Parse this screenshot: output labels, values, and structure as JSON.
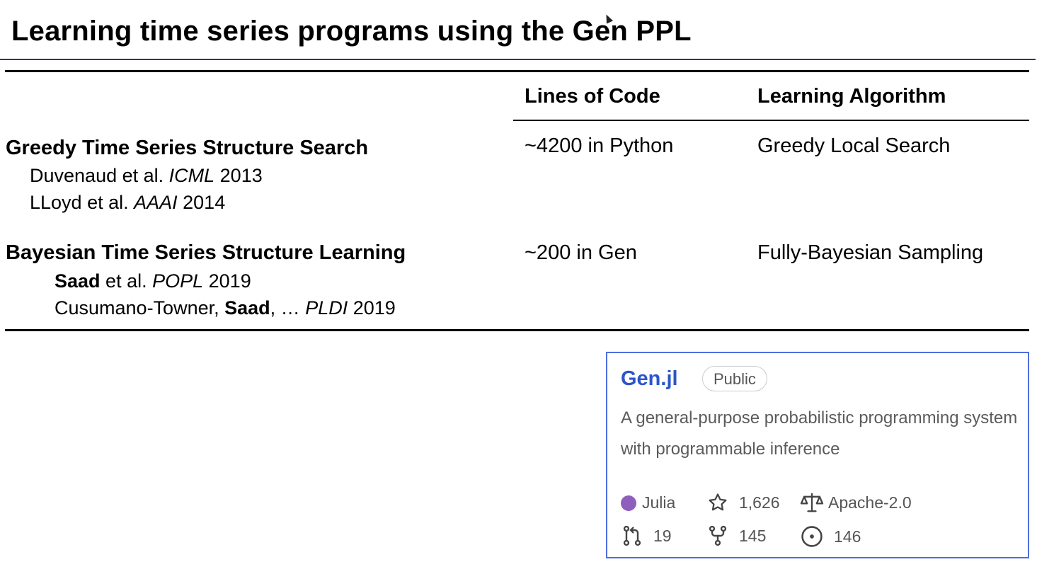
{
  "slide": {
    "title": "Learning time series programs using the Gen PPL"
  },
  "table": {
    "headers": [
      "Lines of Code",
      "Learning Algorithm"
    ],
    "rows": [
      {
        "name": "Greedy Time Series Structure Search",
        "lines_of_code": "~4200 in Python",
        "algorithm": "Greedy Local Search",
        "refs": [
          {
            "pre": "Duvenaud et al. ",
            "venue": "ICML",
            "year": " 2013"
          },
          {
            "pre": "LLoyd et al. ",
            "venue": "AAAI",
            "year": " 2014"
          }
        ]
      },
      {
        "name": "Bayesian Time Series Structure Learning",
        "lines_of_code": "~200 in Gen",
        "algorithm": "Fully-Bayesian Sampling",
        "refs": [
          {
            "bold": "Saad",
            "pre": " et al. ",
            "venue": "POPL",
            "year": " 2019"
          },
          {
            "lead": "Cusumano-Towner, ",
            "bold": "Saad",
            "pre": ", … ",
            "venue": "PLDI",
            "year": " 2019"
          }
        ]
      }
    ]
  },
  "repo_card": {
    "name": "Gen.jl",
    "visibility": "Public",
    "description": "A general-purpose probabilistic programming system with programmable inference",
    "language": "Julia",
    "language_color": "#8e5fbd",
    "stars": "1,626",
    "license": "Apache-2.0",
    "pull_requests": "19",
    "forks": "145",
    "issues": "146",
    "accent_color": "#2b56c9",
    "border_color": "#4f6fe0"
  }
}
